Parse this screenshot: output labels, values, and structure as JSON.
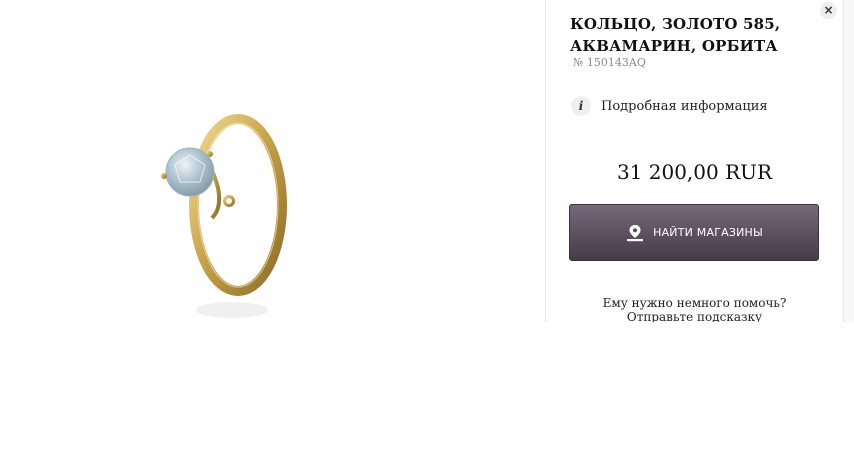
{
  "product": {
    "title_line1": "КОЛЬЦО, ЗОЛОТО 585,",
    "title_line2": "АКВАМАРИН, ОРБИТА",
    "sku": "№ 150143AQ",
    "details_label": "Подробная информация",
    "price": "31 200,00 RUR"
  },
  "actions": {
    "find_stores_label": "НАЙТИ МАГАЗИНЫ",
    "close_label": "×"
  },
  "help": {
    "question": "Ему нужно немного помочь?",
    "link": "Отправьте подсказку"
  },
  "colors": {
    "button_top": "#76687a",
    "button_bottom": "#453b48",
    "gold": "#c9a44c"
  }
}
